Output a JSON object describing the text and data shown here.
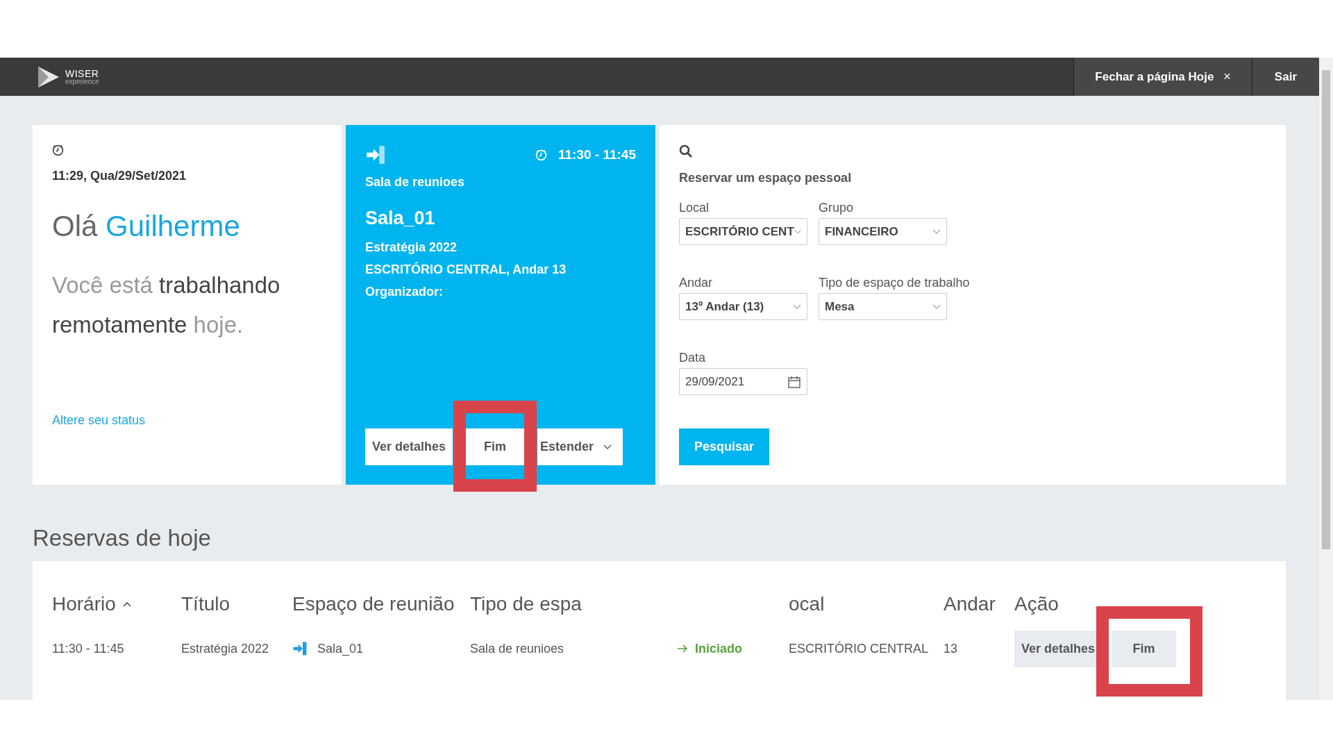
{
  "topbar": {
    "logo_name": "WISER",
    "logo_sub": "experience",
    "close_button": {
      "label": "Fechar a página Hoje",
      "icon": "×"
    },
    "exit_button": "Sair"
  },
  "greeting": {
    "datetime": "11:29, Qua/29/Set/2021",
    "hello": "Olá",
    "name": "Guilherme",
    "status_text": "Você está **trabalhando remotamente** hoje.",
    "change_status_link": "Altere seu status"
  },
  "current_meeting": {
    "time": "11:30 - 11:45",
    "space_type": "Sala de reunioes",
    "space": "Sala_01",
    "title": "Estratégia 2022",
    "location": "ESCRITÓRIO CENTRAL, Andar 13",
    "organizer": "Organizador:",
    "buttons": [
      {
        "label": "Ver detalhes",
        "kind": "plain",
        "highlighted": false
      },
      {
        "label": "Fim",
        "kind": "plain",
        "highlighted": true
      },
      {
        "label": "Estender",
        "kind": "dropdown",
        "highlighted": false
      }
    ]
  },
  "booking_form": {
    "title": "Reservar um espaço pessoal",
    "fields": [
      {
        "label": "Local",
        "value": "ESCRITÓRIO CENT",
        "kind": "select"
      },
      {
        "label": "Grupo",
        "value": "FINANCEIRO",
        "kind": "select"
      },
      {
        "label": "Andar",
        "value": "13º Andar (13)",
        "kind": "select"
      },
      {
        "label": "Tipo de espaço de trabalho",
        "value": "Mesa",
        "kind": "select"
      },
      {
        "label": "Data",
        "value": "29/09/2021",
        "kind": "date"
      }
    ],
    "search_button": "Pesquisar"
  },
  "todays_bookings": {
    "title": "Reservas de hoje",
    "columns": [
      {
        "label": "Horário",
        "sorted": true
      },
      {
        "label": "Título",
        "sorted": false
      },
      {
        "label": "Espaço de reunião",
        "sorted": false
      },
      {
        "label": "Tipo de espa",
        "sorted": false
      },
      {
        "sorted": false
      },
      {
        "label": "ocal",
        "sorted": false
      },
      {
        "label": "Andar",
        "sorted": false
      },
      {
        "label": "Ação",
        "sorted": false
      }
    ],
    "rows": [
      {
        "cells": [
          {
            "kind": "text",
            "text": "11:30 - 11:45"
          },
          {
            "kind": "text",
            "text": "Estratégia 2022"
          },
          {
            "kind": "space",
            "text": "Sala_01"
          },
          {
            "kind": "text",
            "text": "Sala de reunioes"
          },
          {
            "kind": "status",
            "text": "Iniciado"
          },
          {
            "kind": "text",
            "text": "ESCRITÓRIO CENTRAL"
          },
          {
            "kind": "text",
            "text": "13"
          },
          {
            "kind": "actions",
            "buttons": [
              {
                "label": "Ver detalhes",
                "highlighted": false
              },
              {
                "label": "Fim",
                "highlighted": true
              }
            ]
          }
        ]
      }
    ]
  }
}
